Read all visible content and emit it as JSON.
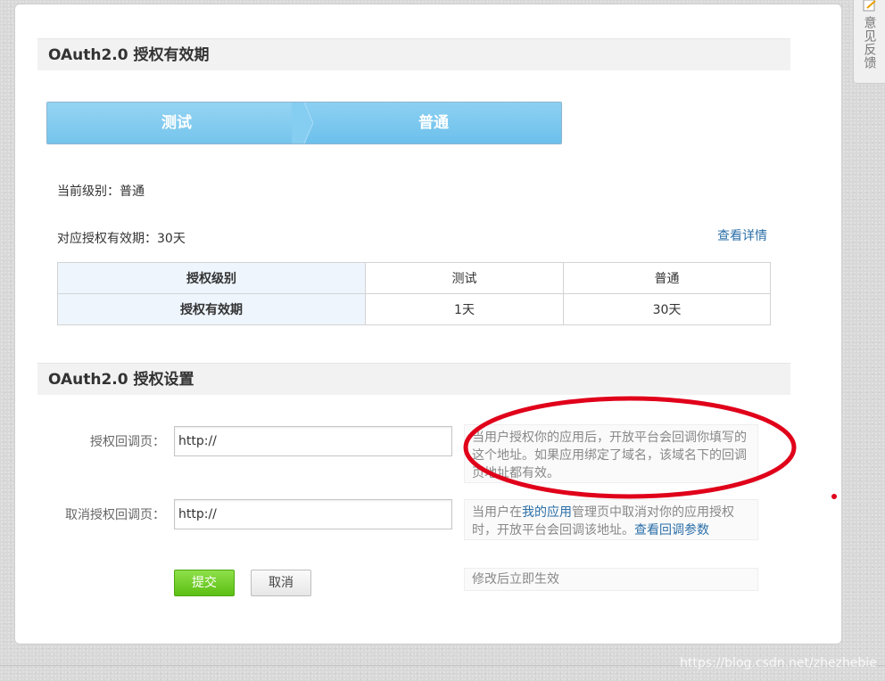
{
  "sections": {
    "validity_title": "OAuth2.0 授权有效期",
    "settings_title": "OAuth2.0 授权设置"
  },
  "steps": [
    "测试",
    "普通"
  ],
  "current_level": "当前级别：普通",
  "validity_period": "对应授权有效期：30天",
  "detail_link": "查看详情",
  "levels_table": {
    "rows": [
      {
        "header": "授权级别",
        "test": "测试",
        "normal": "普通"
      },
      {
        "header": "授权有效期",
        "test": "1天",
        "normal": "30天"
      }
    ]
  },
  "form": {
    "callback": {
      "label": "授权回调页：",
      "value": "http://",
      "tip": "当用户授权你的应用后，开放平台会回调你填写的这个地址。如果应用绑定了域名，该域名下的回调页地址都有效。"
    },
    "cancel_callback": {
      "label": "取消授权回调页：",
      "value": "http://",
      "tip_prefix": "当用户在",
      "tip_link": "我的应用",
      "tip_middle": "管理页中取消对你的应用授权时，开放平台会回调该地址。",
      "tip_link2": "查看回调参数"
    },
    "effect_tip": "修改后立即生效"
  },
  "buttons": {
    "submit": "提交",
    "cancel": "取消"
  },
  "feedback": "意见反馈",
  "watermark": "https://blog.csdn.net/zhezhebie",
  "colors": {
    "accent_green": "#5cbf12",
    "step_blue": "#75c4ec",
    "link_blue": "#2b6fa8",
    "annotation_red": "#e0001a"
  }
}
